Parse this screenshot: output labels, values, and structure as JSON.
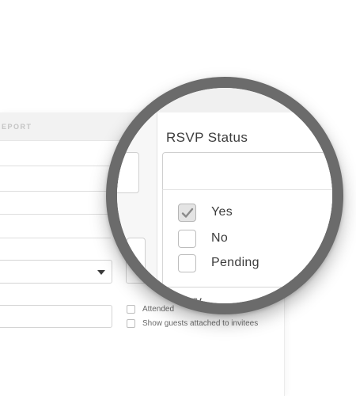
{
  "background_form": {
    "header_label": "EPORT",
    "checkboxes": [
      {
        "label": "Attended",
        "checked": false
      },
      {
        "label": "Show guests attached to invitees",
        "checked": false
      }
    ]
  },
  "magnifier": {
    "section_title": "RSVP Status",
    "options": [
      {
        "label": "Yes",
        "checked": true
      },
      {
        "label": "No",
        "checked": false
      },
      {
        "label": "Pending",
        "checked": false
      }
    ],
    "next_section_partial": "ory"
  },
  "colors": {
    "magnifier_ring": "#6b6b6b",
    "header_bg": "#f2f2f2",
    "checked_fill": "#e4e4e4"
  }
}
